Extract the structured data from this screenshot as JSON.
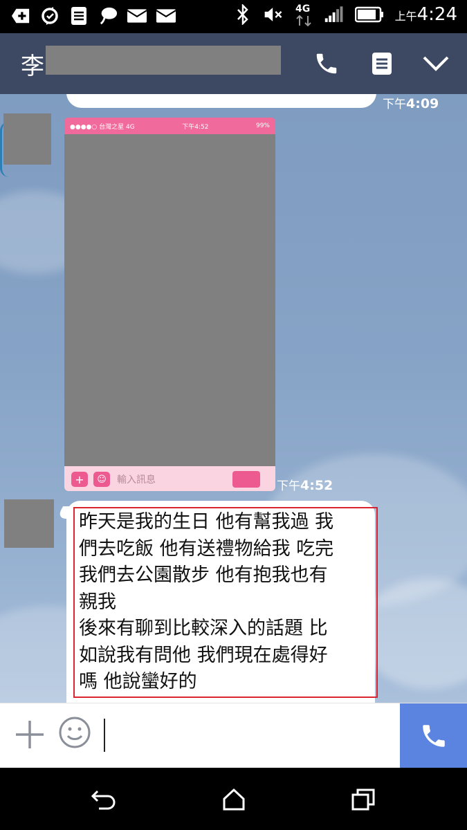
{
  "status_bar": {
    "time_prefix": "上午",
    "time": "4:24",
    "network": "4G",
    "icons": [
      "add-box-icon",
      "sync-icon",
      "document-icon",
      "chat-bubble-icon",
      "mail-icon",
      "mail-icon",
      "bluetooth-icon",
      "mute-icon",
      "4g-icon",
      "signal-icon",
      "battery-icon"
    ]
  },
  "header": {
    "contact_name": "李",
    "icons": [
      "phone-icon",
      "notes-icon",
      "chevron-down-icon"
    ]
  },
  "chat": {
    "top_timestamp": {
      "prefix": "下午",
      "time": "4:09"
    },
    "image_message": {
      "inner_status": {
        "carrier": "●●●●○ 台灣之星 4G",
        "time": "下午4:52",
        "battery": "99%"
      },
      "inner_input_placeholder": "輸入訊息",
      "timestamp": {
        "prefix": "下午",
        "time": "4:52"
      }
    },
    "text_message": {
      "lines": [
        "昨天是我的生日 他有幫我過 我",
        "們去吃飯 他有送禮物給我 吃完",
        "我們去公園散步 他有抱我也有",
        "親我",
        "後來有聊到比較深入的話題 比",
        "如說我有問他 我們現在處得好",
        "嗎 他說蠻好的"
      ],
      "highlight_color": "#d9242f"
    }
  },
  "input_bar": {
    "icons": [
      "plus-icon",
      "emoji-icon",
      "phone-icon"
    ],
    "accent": "#5a84e0"
  },
  "nav_bar": {
    "icons": [
      "back-icon",
      "home-icon",
      "recents-icon"
    ]
  },
  "colors": {
    "header_bg": "#3d4863",
    "chat_bg": "#87a3c6",
    "pink": "#f06b9b"
  }
}
